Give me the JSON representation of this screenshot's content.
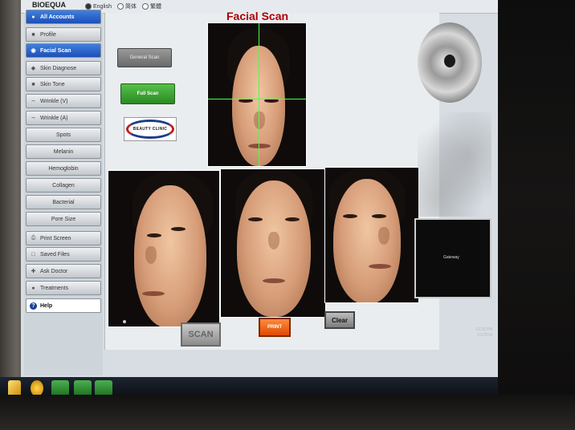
{
  "app": {
    "brand": "BIOEQUA",
    "languages": [
      {
        "label": "English",
        "selected": true
      },
      {
        "label": "简体",
        "selected": false
      },
      {
        "label": "繁體",
        "selected": false
      }
    ]
  },
  "sidebar": {
    "items": [
      {
        "label": "All Accounts",
        "icon": "users-icon",
        "active": true
      },
      {
        "label": "Profile",
        "icon": "profile-icon",
        "active": false
      },
      {
        "label": "Facial Scan",
        "icon": "camera-icon",
        "active": true
      },
      {
        "label": "Skin Diagnose",
        "icon": "diagnose-icon",
        "active": false
      },
      {
        "label": "Skin Tone",
        "icon": "tone-icon",
        "active": false
      },
      {
        "label": "Wrinkle (V)",
        "icon": "wrinkle-icon",
        "active": false
      },
      {
        "label": "Wrinkle (A)",
        "icon": "wrinkle-icon",
        "active": false
      },
      {
        "label": "Spots",
        "icon": "",
        "active": false
      },
      {
        "label": "Melanin",
        "icon": "",
        "active": false
      },
      {
        "label": "Hemoglobin",
        "icon": "",
        "active": false
      },
      {
        "label": "Collagen",
        "icon": "",
        "active": false
      },
      {
        "label": "Bacterial",
        "icon": "",
        "active": false
      },
      {
        "label": "Pore Size",
        "icon": "",
        "active": false
      },
      {
        "label": "Print Screen",
        "icon": "printer-icon",
        "active": false
      },
      {
        "label": "Saved Files",
        "icon": "folder-icon",
        "active": false
      },
      {
        "label": "Ask Doctor",
        "icon": "plus-icon",
        "active": false
      },
      {
        "label": "Treatments",
        "icon": "treatment-icon",
        "active": false
      },
      {
        "label": "Help",
        "icon": "help-icon",
        "active": false
      }
    ]
  },
  "main": {
    "title": "Facial Scan",
    "general_scan_label": "General Scan",
    "full_scan_label": "Full Scan",
    "logo_text": "BEAUTY CLINIC",
    "scan_label": "SCAN",
    "print_label": "PRINT",
    "clear_label": "Clear"
  },
  "desktop": {
    "gateway_text": "Gateway",
    "clock_time": "12:25 PM",
    "clock_date": "1/1/2010"
  },
  "colors": {
    "accent": "#b00000",
    "active_nav": "#1c4fb8",
    "full_scan": "#2a8a23",
    "print": "#e04a00",
    "crosshair": "#4cff4c"
  }
}
